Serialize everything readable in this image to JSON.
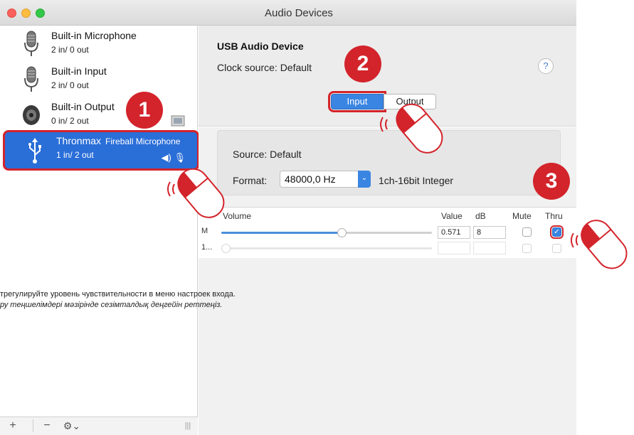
{
  "window": {
    "title": "Audio Devices"
  },
  "devices": [
    {
      "name": "Built-in Microphone",
      "io": "2 in/ 0 out",
      "icon": "microphone-icon"
    },
    {
      "name": "Built-in Input",
      "io": "2 in/ 0 out",
      "icon": "microphone-icon"
    },
    {
      "name": "Built-in Output",
      "io": "0 in/ 2 out",
      "icon": "speaker-icon"
    },
    {
      "name": "Thronmax",
      "sub": "Fireball Microphone",
      "io": "1 in/ 2 out",
      "icon": "usb-icon",
      "selected": true
    }
  ],
  "detail": {
    "device_title": "USB Audio Device",
    "clock_source": "Clock source:  Default",
    "help": "?",
    "tabs": {
      "input": "Input",
      "output": "Output"
    },
    "source": "Source:  Default",
    "format_label": "Format:",
    "format_value": "48000,0 Hz",
    "format_desc": "1ch-16bit Integer"
  },
  "volume_table": {
    "headers": {
      "volume": "Volume",
      "value": "Value",
      "db": "dB",
      "mute": "Mute",
      "thru": "Thru"
    },
    "rows": [
      {
        "label": "M",
        "level": 0.571,
        "value": "0.571",
        "db": "8",
        "mute": false,
        "thru": true
      },
      {
        "label": "1...",
        "level": 0.0,
        "value": "",
        "db": "",
        "mute": false,
        "thru": false
      }
    ]
  },
  "callouts": {
    "one": "1",
    "two": "2",
    "three": "3"
  },
  "instructions": {
    "ru": "трегулируйте уровень чувствительности в меню настроек входа.",
    "kk": "ру теңшелімдері мәзірінде сезімталдық деңгейін реттеңіз."
  },
  "colors": {
    "accent": "#3a85e2",
    "callout": "#d3242b",
    "selection": "#2a6ed8"
  }
}
